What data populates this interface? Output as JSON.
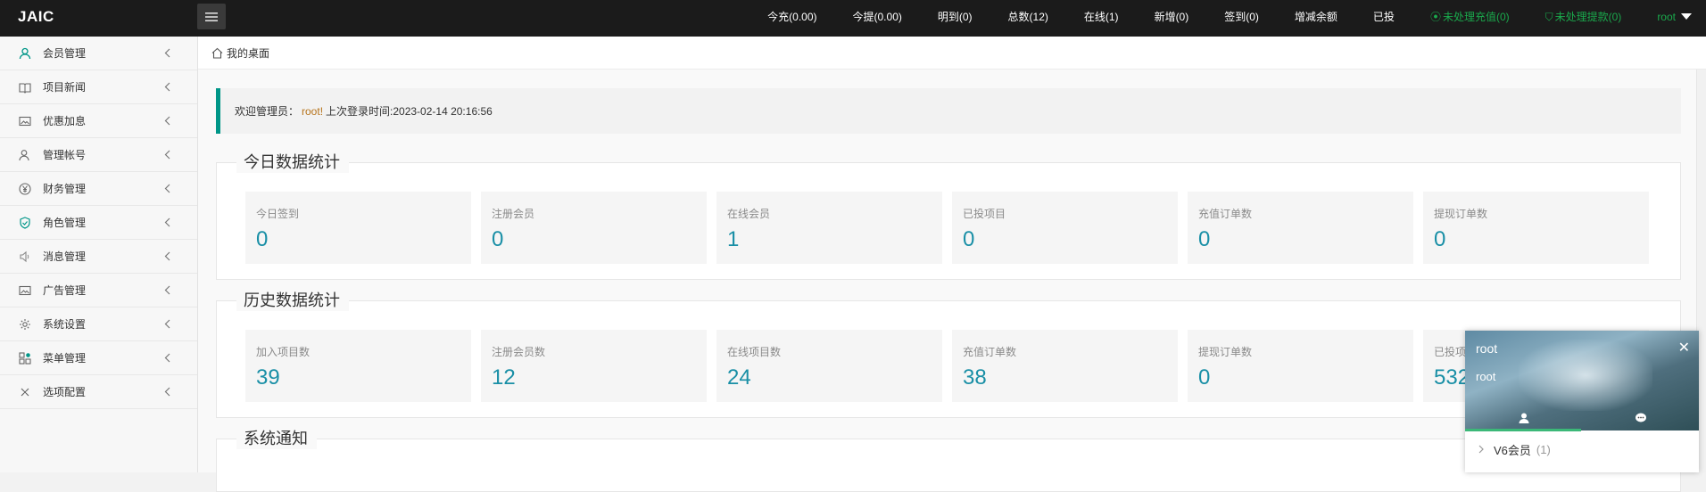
{
  "app": {
    "logo": "JAIC"
  },
  "topnav": {
    "items": [
      "今充(0.00)",
      "今提(0.00)",
      "明到(0)",
      "总数(12)",
      "在线(1)",
      "新增(0)",
      "签到(0)",
      "增减余额",
      "已投"
    ],
    "recharge_alert": "未处理充值(0)",
    "withdraw_alert": "未处理提款(0)",
    "user": "root"
  },
  "sidebar": {
    "items": [
      {
        "label": "会员管理",
        "icon": "user-icon"
      },
      {
        "label": "项目新闻",
        "icon": "book-icon"
      },
      {
        "label": "优惠加息",
        "icon": "image-icon"
      },
      {
        "label": "管理帐号",
        "icon": "users-icon"
      },
      {
        "label": "财务管理",
        "icon": "yen-icon"
      },
      {
        "label": "角色管理",
        "icon": "shield-icon"
      },
      {
        "label": "消息管理",
        "icon": "speaker-icon"
      },
      {
        "label": "广告管理",
        "icon": "image-icon"
      },
      {
        "label": "系统设置",
        "icon": "gear-icon"
      },
      {
        "label": "菜单管理",
        "icon": "app-icon"
      },
      {
        "label": "选项配置",
        "icon": "options-icon"
      }
    ]
  },
  "breadcrumb": {
    "label": "我的桌面"
  },
  "welcome": {
    "prefix": "欢迎管理员：",
    "username": "root!",
    "last_login": "上次登录时间:2023-02-14 20:16:56"
  },
  "today": {
    "title": "今日数据统计",
    "cards": [
      {
        "label": "今日签到",
        "value": "0"
      },
      {
        "label": "注册会员",
        "value": "0"
      },
      {
        "label": "在线会员",
        "value": "1"
      },
      {
        "label": "已投项目",
        "value": "0"
      },
      {
        "label": "充值订单数",
        "value": "0"
      },
      {
        "label": "提现订单数",
        "value": "0"
      }
    ]
  },
  "history": {
    "title": "历史数据统计",
    "cards": [
      {
        "label": "加入项目数",
        "value": "39"
      },
      {
        "label": "注册会员数",
        "value": "12"
      },
      {
        "label": "在线项目数",
        "value": "24"
      },
      {
        "label": "充值订单数",
        "value": "38"
      },
      {
        "label": "提现订单数",
        "value": "0"
      },
      {
        "label": "已投项",
        "value": "532"
      }
    ]
  },
  "notice": {
    "title": "系统通知"
  },
  "chat": {
    "name": "root",
    "subtitle": "root",
    "group_label": "V6会员",
    "group_count": "(1)"
  },
  "colors": {
    "accent": "#009688",
    "value": "#198fa6",
    "alert": "#1aa94c",
    "topbar": "#1b1b1b"
  }
}
